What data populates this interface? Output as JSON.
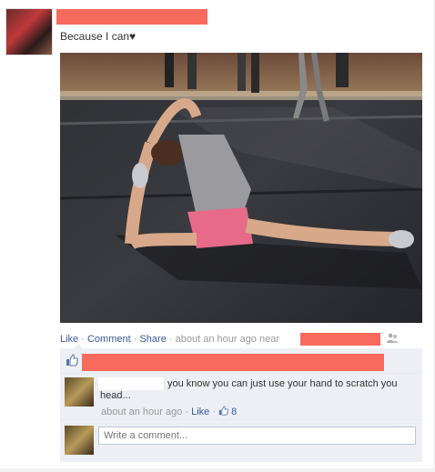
{
  "post": {
    "caption": "Because I can♥",
    "photo_subject": "girl doing a split stretch on gym mat",
    "actions": {
      "like": "Like",
      "comment": "Comment",
      "share": "Share",
      "time": "about an hour ago near"
    }
  },
  "comments": [
    {
      "text": "you know you can just use your hand to scratch you head...",
      "time": "about an hour ago",
      "like": "Like",
      "like_count": "8"
    }
  ],
  "write_comment": {
    "placeholder": "Write a comment..."
  },
  "colors": {
    "link": "#3b5998",
    "redaction": "#f76a5d",
    "comment_bg": "#edeff4"
  }
}
